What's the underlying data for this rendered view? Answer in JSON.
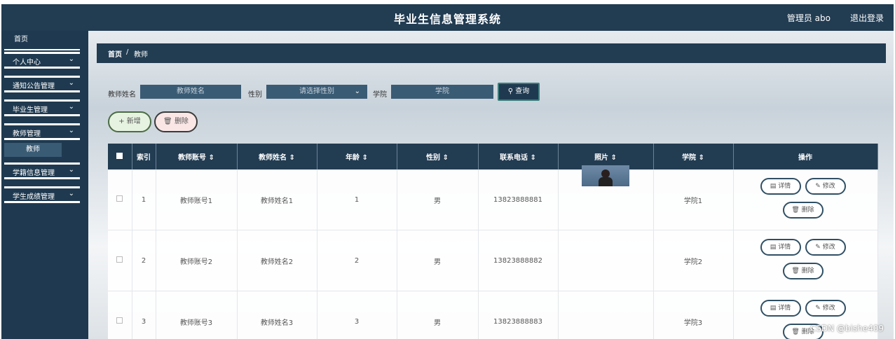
{
  "header": {
    "title": "毕业生信息管理系统",
    "user": "管理员 abo",
    "logout": "退出登录"
  },
  "sidebar": {
    "top_item": "首页",
    "items": [
      {
        "label": "个人中心"
      },
      {
        "label": "通知公告管理"
      },
      {
        "label": "毕业生管理"
      },
      {
        "label": "教师管理"
      },
      {
        "label": "学籍信息管理"
      },
      {
        "label": "学生成绩管理"
      }
    ],
    "active_sub": "教师"
  },
  "breadcrumb": {
    "home": "首页",
    "separator": "/",
    "current": "教师"
  },
  "filters": {
    "name_label": "教师姓名",
    "name_placeholder": "教师姓名",
    "gender_label": "性别",
    "gender_placeholder": "请选择性别",
    "college_label": "学院",
    "college_placeholder": "学院",
    "search_button": "查询"
  },
  "actions": {
    "add": "新增",
    "delete": "删除"
  },
  "table": {
    "headers": [
      "索引",
      "教师账号",
      "教师姓名",
      "年龄",
      "性别",
      "联系电话",
      "照片",
      "学院",
      "操作"
    ],
    "sort_mark": "⇕",
    "rows": [
      {
        "index": "1",
        "account": "教师账号1",
        "name": "教师姓名1",
        "age": "1",
        "gender": "男",
        "phone": "13823888881",
        "college": "学院1",
        "has_photo": true
      },
      {
        "index": "2",
        "account": "教师账号2",
        "name": "教师姓名2",
        "age": "2",
        "gender": "男",
        "phone": "13823888882",
        "college": "学院2",
        "has_photo": false
      },
      {
        "index": "3",
        "account": "教师账号3",
        "name": "教师姓名3",
        "age": "3",
        "gender": "男",
        "phone": "13823888883",
        "college": "学院3",
        "has_photo": false
      }
    ],
    "row_actions": {
      "detail": "详情",
      "edit": "修改",
      "delete": "删除"
    }
  },
  "watermark": "CSDN @bishe409",
  "colors": {
    "header": "#223c52",
    "sidebar": "#1f3a50",
    "input": "#3a5b74",
    "add_button_bg": "#e6f3e1",
    "delete_button_bg": "#fbe6e6"
  }
}
